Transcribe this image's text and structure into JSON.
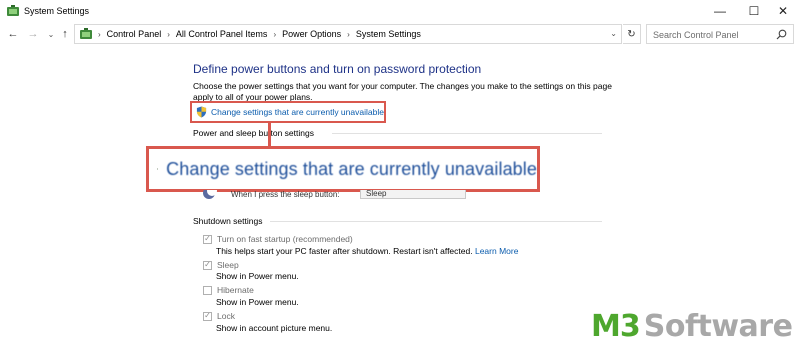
{
  "window": {
    "title": "System Settings",
    "min_glyph": "—",
    "max_glyph": "☐",
    "close_glyph": "✕"
  },
  "address": {
    "crumbs": [
      "Control Panel",
      "All Control Panel Items",
      "Power Options",
      "System Settings"
    ],
    "search_placeholder": "Search Control Panel"
  },
  "page": {
    "title": "Define power buttons and turn on password protection",
    "description": "Choose the power settings that you want for your computer. The changes you make to the settings on this page apply to all of your power plans.",
    "change_link": "Change settings that are currently unavailable",
    "power_sleep_heading": "Power and sleep button settings",
    "sleep_button_label": "When I press the sleep button:",
    "sleep_button_value": "Sleep",
    "shutdown_heading": "Shutdown settings"
  },
  "callout": {
    "text": "Change settings that are currently unavailable",
    "border_color": "#d9584e"
  },
  "shutdown_options": [
    {
      "label": "Turn on fast startup (recommended)",
      "checked": true,
      "description": "This helps start your PC faster after shutdown. Restart isn't affected.",
      "link": "Learn More"
    },
    {
      "label": "Sleep",
      "checked": true,
      "description": "Show in Power menu.",
      "link": ""
    },
    {
      "label": "Hibernate",
      "checked": false,
      "description": "Show in Power menu.",
      "link": ""
    },
    {
      "label": "Lock",
      "checked": true,
      "description": "Show in account picture menu.",
      "link": ""
    }
  ],
  "watermark": {
    "brand_a": "M3",
    "brand_b": "Software",
    "color_a": "#4ea72e",
    "color_b": "#a8a8a8"
  },
  "colors": {
    "link": "#0b5cad",
    "heading": "#1e3287",
    "disabled_text": "#6d6d6d"
  }
}
